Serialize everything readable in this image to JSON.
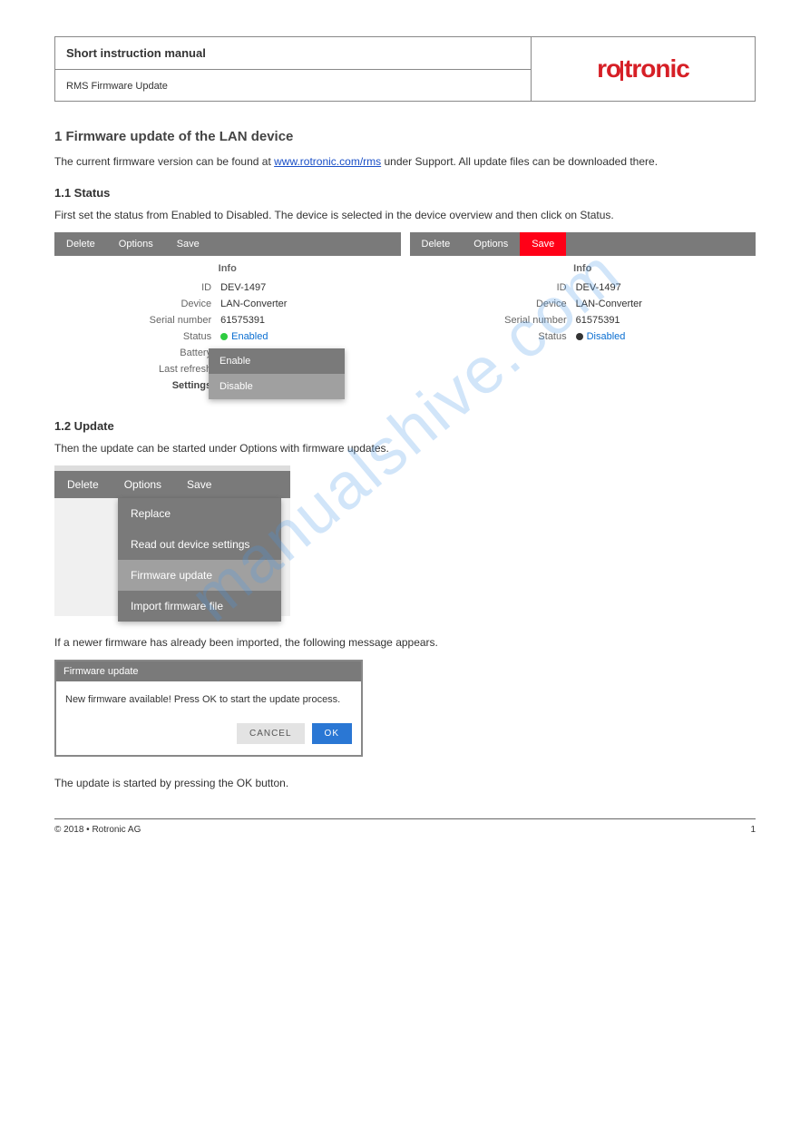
{
  "watermark": "manualshive.com",
  "header": {
    "title": "Short instruction manual",
    "subtitle": "RMS Firmware Update"
  },
  "sections": {
    "s1": {
      "title": "1   Firmware update of the LAN device",
      "text_before": "The current firmware version can be found at ",
      "link": "www.rotronic.com/rms",
      "text_after": " under Support. All update files can be downloaded there."
    },
    "status": {
      "title": "1.1 Status",
      "text": "First set the status from Enabled to Disabled. The device is selected in the device overview and then click on Status."
    },
    "update": {
      "title": "1.2 Update",
      "text1": "Then the update can be started under Options with firmware updates.",
      "text2": "If a newer firmware has already been imported, the following message appears.",
      "text3": "The update is started by pressing the OK button."
    }
  },
  "panel": {
    "delete": "Delete",
    "options": "Options",
    "save": "Save",
    "info": "Info",
    "settings": "Settings",
    "labels": {
      "id": "ID",
      "device": "Device",
      "serial": "Serial number",
      "status": "Status",
      "battery": "Battery",
      "refresh": "Last refresh"
    },
    "values": {
      "id": "DEV-1497",
      "device": "LAN-Converter",
      "serial": "61575391",
      "status_enabled": "Enabled",
      "status_disabled": "Disabled"
    },
    "dropdown": {
      "enable": "Enable",
      "disable": "Disable"
    }
  },
  "options_menu": {
    "replace": "Replace",
    "readout": "Read out device settings",
    "fwupdate": "Firmware update",
    "import": "Import firmware file"
  },
  "dialog": {
    "title": "Firmware update",
    "body": "New firmware available! Press OK to start the update process.",
    "cancel": "CANCEL",
    "ok": "OK"
  },
  "footer": {
    "left": "© 2018 • Rotronic AG",
    "right": "1"
  }
}
